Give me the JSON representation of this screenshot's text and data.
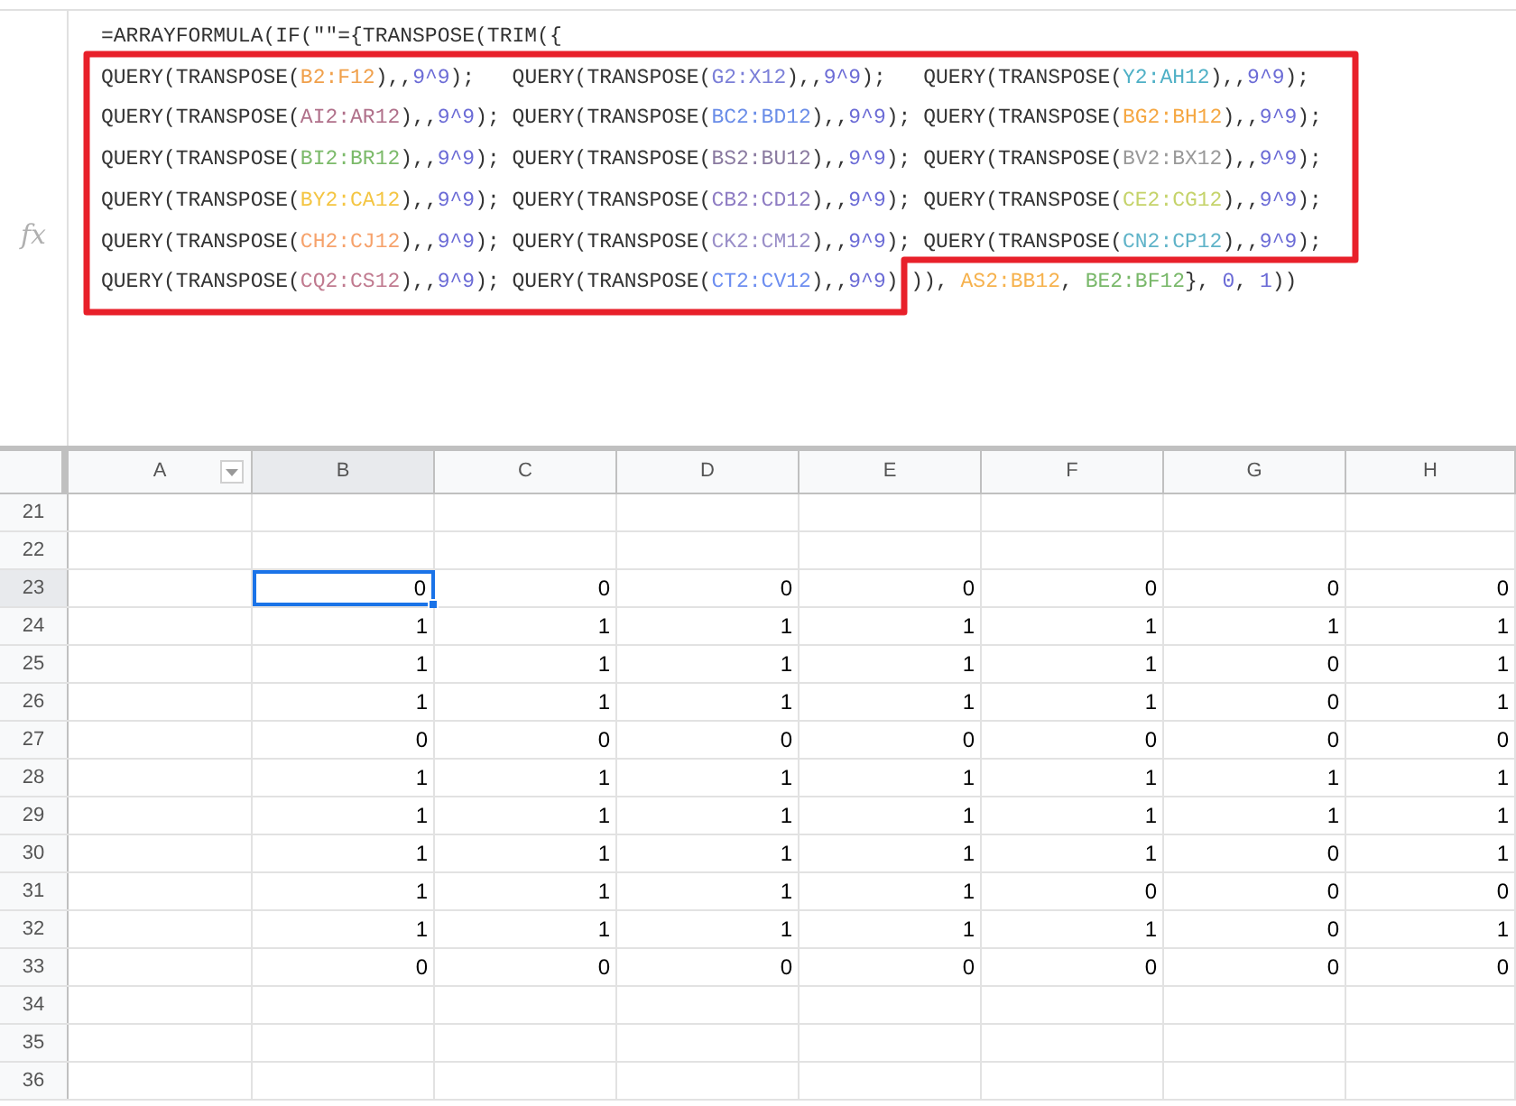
{
  "formula_bar": {
    "icon_label": "fx",
    "lines": [
      [
        {
          "text": "=ARRAYFORMULA(IF(\"\"={TRANSPOSE(TRIM({",
          "color": "#333333"
        }
      ],
      [
        {
          "text": "QUERY(TRANSPOSE(",
          "color": "#333333"
        },
        {
          "text": "B2:F12",
          "color": "#f0a04b"
        },
        {
          "text": "),,",
          "color": "#333333"
        },
        {
          "text": "9^9",
          "color": "#6b6bd6"
        },
        {
          "text": ");   QUERY(TRANSPOSE(",
          "color": "#333333"
        },
        {
          "text": "G2:X12",
          "color": "#7b7fd8"
        },
        {
          "text": "),,",
          "color": "#333333"
        },
        {
          "text": "9^9",
          "color": "#6b6bd6"
        },
        {
          "text": ");   QUERY(TRANSPOSE(",
          "color": "#333333"
        },
        {
          "text": "Y2:AH12",
          "color": "#4fb0c6"
        },
        {
          "text": "),,",
          "color": "#333333"
        },
        {
          "text": "9^9",
          "color": "#6b6bd6"
        },
        {
          "text": ");",
          "color": "#333333"
        }
      ],
      [
        {
          "text": "QUERY(TRANSPOSE(",
          "color": "#333333"
        },
        {
          "text": "AI2:AR12",
          "color": "#b0708a"
        },
        {
          "text": "),,",
          "color": "#333333"
        },
        {
          "text": "9^9",
          "color": "#6b6bd6"
        },
        {
          "text": "); QUERY(TRANSPOSE(",
          "color": "#333333"
        },
        {
          "text": "BC2:BD12",
          "color": "#6a8de8"
        },
        {
          "text": "),,",
          "color": "#333333"
        },
        {
          "text": "9^9",
          "color": "#6b6bd6"
        },
        {
          "text": "); QUERY(TRANSPOSE(",
          "color": "#333333"
        },
        {
          "text": "BG2:BH12",
          "color": "#f5a742"
        },
        {
          "text": "),,",
          "color": "#333333"
        },
        {
          "text": "9^9",
          "color": "#6b6bd6"
        },
        {
          "text": ");",
          "color": "#333333"
        }
      ],
      [
        {
          "text": "QUERY(TRANSPOSE(",
          "color": "#333333"
        },
        {
          "text": "BI2:BR12",
          "color": "#7cba6a"
        },
        {
          "text": "),,",
          "color": "#333333"
        },
        {
          "text": "9^9",
          "color": "#6b6bd6"
        },
        {
          "text": "); QUERY(TRANSPOSE(",
          "color": "#333333"
        },
        {
          "text": "BS2:BU12",
          "color": "#8a7aa0"
        },
        {
          "text": "),,",
          "color": "#333333"
        },
        {
          "text": "9^9",
          "color": "#6b6bd6"
        },
        {
          "text": "); QUERY(TRANSPOSE(",
          "color": "#333333"
        },
        {
          "text": "BV2:BX12",
          "color": "#999999"
        },
        {
          "text": "),,",
          "color": "#333333"
        },
        {
          "text": "9^9",
          "color": "#6b6bd6"
        },
        {
          "text": ");",
          "color": "#333333"
        }
      ],
      [
        {
          "text": "QUERY(TRANSPOSE(",
          "color": "#333333"
        },
        {
          "text": "BY2:CA12",
          "color": "#f4c542"
        },
        {
          "text": "),,",
          "color": "#333333"
        },
        {
          "text": "9^9",
          "color": "#6b6bd6"
        },
        {
          "text": "); QUERY(TRANSPOSE(",
          "color": "#333333"
        },
        {
          "text": "CB2:CD12",
          "color": "#8e7cc3"
        },
        {
          "text": "),,",
          "color": "#333333"
        },
        {
          "text": "9^9",
          "color": "#6b6bd6"
        },
        {
          "text": "); QUERY(TRANSPOSE(",
          "color": "#333333"
        },
        {
          "text": "CE2:CG12",
          "color": "#c5d36a"
        },
        {
          "text": "),,",
          "color": "#333333"
        },
        {
          "text": "9^9",
          "color": "#6b6bd6"
        },
        {
          "text": ");",
          "color": "#333333"
        }
      ],
      [
        {
          "text": "QUERY(TRANSPOSE(",
          "color": "#333333"
        },
        {
          "text": "CH2:CJ12",
          "color": "#f6a26b"
        },
        {
          "text": "),,",
          "color": "#333333"
        },
        {
          "text": "9^9",
          "color": "#6b6bd6"
        },
        {
          "text": "); QUERY(TRANSPOSE(",
          "color": "#333333"
        },
        {
          "text": "CK2:CM12",
          "color": "#9a8fc8"
        },
        {
          "text": "),,",
          "color": "#333333"
        },
        {
          "text": "9^9",
          "color": "#6b6bd6"
        },
        {
          "text": "); QUERY(TRANSPOSE(",
          "color": "#333333"
        },
        {
          "text": "CN2:CP12",
          "color": "#5fb3c8"
        },
        {
          "text": "),,",
          "color": "#333333"
        },
        {
          "text": "9^9",
          "color": "#6b6bd6"
        },
        {
          "text": ");",
          "color": "#333333"
        }
      ],
      [
        {
          "text": "QUERY(TRANSPOSE(",
          "color": "#333333"
        },
        {
          "text": "CQ2:CS12",
          "color": "#c07a8f"
        },
        {
          "text": "),,",
          "color": "#333333"
        },
        {
          "text": "9^9",
          "color": "#6b6bd6"
        },
        {
          "text": "); QUERY(TRANSPOSE(",
          "color": "#333333"
        },
        {
          "text": "CT2:CV12",
          "color": "#6d8ef0"
        },
        {
          "text": "),,",
          "color": "#333333"
        },
        {
          "text": "9^9",
          "color": "#6b6bd6"
        },
        {
          "text": ") ",
          "color": "#333333"
        },
        {
          "text": ")), ",
          "color": "#333333"
        },
        {
          "text": "AS2:BB12",
          "color": "#f6b24e"
        },
        {
          "text": ", ",
          "color": "#333333"
        },
        {
          "text": "BE2:BF12",
          "color": "#79b86a"
        },
        {
          "text": "}, ",
          "color": "#333333"
        },
        {
          "text": "0",
          "color": "#6b6bd6"
        },
        {
          "text": ", ",
          "color": "#333333"
        },
        {
          "text": "1",
          "color": "#6b6bd6"
        },
        {
          "text": "))",
          "color": "#333333"
        }
      ]
    ]
  },
  "grid": {
    "columns": [
      {
        "label": "A",
        "selected": false,
        "filter": true
      },
      {
        "label": "B",
        "selected": true,
        "filter": false
      },
      {
        "label": "C",
        "selected": false,
        "filter": false
      },
      {
        "label": "D",
        "selected": false,
        "filter": false
      },
      {
        "label": "E",
        "selected": false,
        "filter": false
      },
      {
        "label": "F",
        "selected": false,
        "filter": false
      },
      {
        "label": "G",
        "selected": false,
        "filter": false
      },
      {
        "label": "H",
        "selected": false,
        "filter": false
      }
    ],
    "rows": [
      {
        "number": "21",
        "selected": false,
        "cells": []
      },
      {
        "number": "22",
        "selected": false,
        "cells": []
      },
      {
        "number": "23",
        "selected": true,
        "cells": [
          {
            "value": "0",
            "selected": true
          },
          {
            "value": "0",
            "selected": false
          },
          {
            "value": "0",
            "selected": false
          },
          {
            "value": "0",
            "selected": false
          },
          {
            "value": "0",
            "selected": false
          },
          {
            "value": "0",
            "selected": false
          },
          {
            "value": "0",
            "selected": false
          }
        ]
      },
      {
        "number": "24",
        "selected": false,
        "cells": [
          {
            "value": "1",
            "selected": false
          },
          {
            "value": "1",
            "selected": false
          },
          {
            "value": "1",
            "selected": false
          },
          {
            "value": "1",
            "selected": false
          },
          {
            "value": "1",
            "selected": false
          },
          {
            "value": "1",
            "selected": false
          },
          {
            "value": "1",
            "selected": false
          }
        ]
      },
      {
        "number": "25",
        "selected": false,
        "cells": [
          {
            "value": "1",
            "selected": false
          },
          {
            "value": "1",
            "selected": false
          },
          {
            "value": "1",
            "selected": false
          },
          {
            "value": "1",
            "selected": false
          },
          {
            "value": "1",
            "selected": false
          },
          {
            "value": "0",
            "selected": false
          },
          {
            "value": "1",
            "selected": false
          }
        ]
      },
      {
        "number": "26",
        "selected": false,
        "cells": [
          {
            "value": "1",
            "selected": false
          },
          {
            "value": "1",
            "selected": false
          },
          {
            "value": "1",
            "selected": false
          },
          {
            "value": "1",
            "selected": false
          },
          {
            "value": "1",
            "selected": false
          },
          {
            "value": "0",
            "selected": false
          },
          {
            "value": "1",
            "selected": false
          }
        ]
      },
      {
        "number": "27",
        "selected": false,
        "cells": [
          {
            "value": "0",
            "selected": false
          },
          {
            "value": "0",
            "selected": false
          },
          {
            "value": "0",
            "selected": false
          },
          {
            "value": "0",
            "selected": false
          },
          {
            "value": "0",
            "selected": false
          },
          {
            "value": "0",
            "selected": false
          },
          {
            "value": "0",
            "selected": false
          }
        ]
      },
      {
        "number": "28",
        "selected": false,
        "cells": [
          {
            "value": "1",
            "selected": false
          },
          {
            "value": "1",
            "selected": false
          },
          {
            "value": "1",
            "selected": false
          },
          {
            "value": "1",
            "selected": false
          },
          {
            "value": "1",
            "selected": false
          },
          {
            "value": "1",
            "selected": false
          },
          {
            "value": "1",
            "selected": false
          }
        ]
      },
      {
        "number": "29",
        "selected": false,
        "cells": [
          {
            "value": "1",
            "selected": false
          },
          {
            "value": "1",
            "selected": false
          },
          {
            "value": "1",
            "selected": false
          },
          {
            "value": "1",
            "selected": false
          },
          {
            "value": "1",
            "selected": false
          },
          {
            "value": "1",
            "selected": false
          },
          {
            "value": "1",
            "selected": false
          }
        ]
      },
      {
        "number": "30",
        "selected": false,
        "cells": [
          {
            "value": "1",
            "selected": false
          },
          {
            "value": "1",
            "selected": false
          },
          {
            "value": "1",
            "selected": false
          },
          {
            "value": "1",
            "selected": false
          },
          {
            "value": "1",
            "selected": false
          },
          {
            "value": "0",
            "selected": false
          },
          {
            "value": "1",
            "selected": false
          }
        ]
      },
      {
        "number": "31",
        "selected": false,
        "cells": [
          {
            "value": "1",
            "selected": false
          },
          {
            "value": "1",
            "selected": false
          },
          {
            "value": "1",
            "selected": false
          },
          {
            "value": "1",
            "selected": false
          },
          {
            "value": "0",
            "selected": false
          },
          {
            "value": "0",
            "selected": false
          },
          {
            "value": "0",
            "selected": false
          }
        ]
      },
      {
        "number": "32",
        "selected": false,
        "cells": [
          {
            "value": "1",
            "selected": false
          },
          {
            "value": "1",
            "selected": false
          },
          {
            "value": "1",
            "selected": false
          },
          {
            "value": "1",
            "selected": false
          },
          {
            "value": "1",
            "selected": false
          },
          {
            "value": "0",
            "selected": false
          },
          {
            "value": "1",
            "selected": false
          }
        ]
      },
      {
        "number": "33",
        "selected": false,
        "cells": [
          {
            "value": "0",
            "selected": false
          },
          {
            "value": "0",
            "selected": false
          },
          {
            "value": "0",
            "selected": false
          },
          {
            "value": "0",
            "selected": false
          },
          {
            "value": "0",
            "selected": false
          },
          {
            "value": "0",
            "selected": false
          },
          {
            "value": "0",
            "selected": false
          }
        ]
      },
      {
        "number": "34",
        "selected": false,
        "cells": []
      },
      {
        "number": "35",
        "selected": false,
        "cells": []
      },
      {
        "number": "36",
        "selected": false,
        "cells": []
      }
    ]
  }
}
